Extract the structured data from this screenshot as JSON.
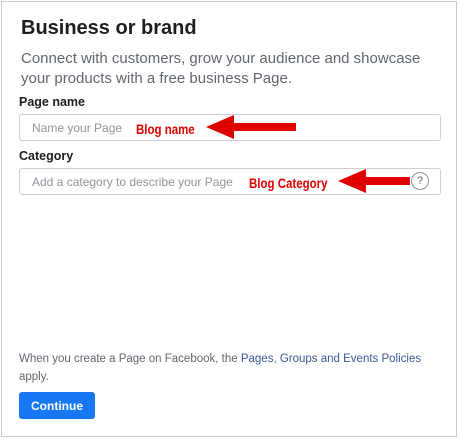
{
  "header": {
    "title": "Business or brand",
    "description": "Connect with customers, grow your audience and showcase your products with a free business Page."
  },
  "form": {
    "page_name": {
      "label": "Page name",
      "placeholder": "Name your Page"
    },
    "category": {
      "label": "Category",
      "placeholder": "Add a category to describe your Page",
      "help_icon": "question-mark-icon",
      "help_glyph": "?"
    }
  },
  "annotations": {
    "blog_name": "Blog name",
    "blog_category": "Blog Category",
    "color": "#e00000"
  },
  "footer": {
    "text_before": "When you create a Page on Facebook, the ",
    "link_pages": "Pages",
    "sep": ", ",
    "link_groups": "Groups and Events Policies",
    "text_after": " apply."
  },
  "actions": {
    "continue_label": "Continue"
  },
  "colors": {
    "accent": "#1877f2",
    "link": "#385898"
  }
}
